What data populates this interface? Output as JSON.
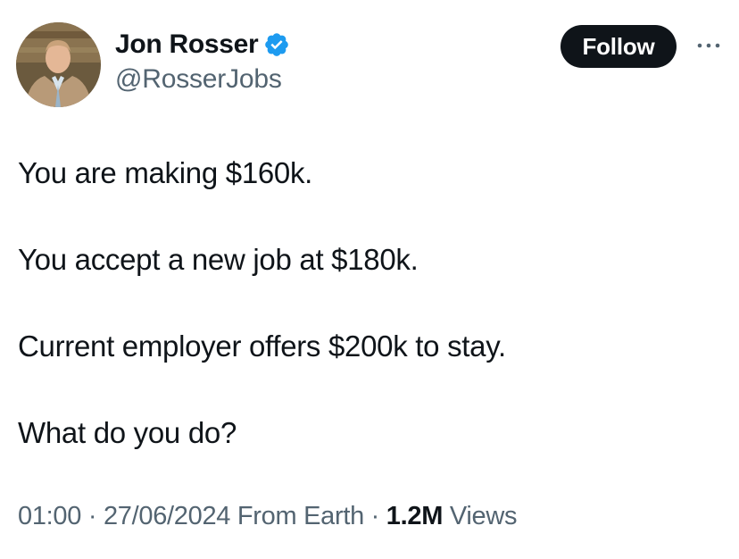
{
  "author": {
    "display_name": "Jon Rosser",
    "handle": "@RosserJobs",
    "verified_icon": "verified-badge-icon",
    "avatar_icon": "profile-photo"
  },
  "actions": {
    "follow_label": "Follow",
    "more_icon": "more-options-icon"
  },
  "tweet": {
    "lines": [
      "You are making $160k.",
      "You accept a new job at $180k.",
      "Current employer offers $200k to stay.",
      "What do you do?"
    ]
  },
  "meta": {
    "time": "01:00",
    "separator": " · ",
    "date": "27/06/2024",
    "source": "From Earth",
    "views_count": "1.2M",
    "views_label": "Views"
  },
  "colors": {
    "text_primary": "#0f1419",
    "text_secondary": "#536471",
    "verified_blue": "#1d9bf0",
    "follow_bg": "#0f1419"
  }
}
